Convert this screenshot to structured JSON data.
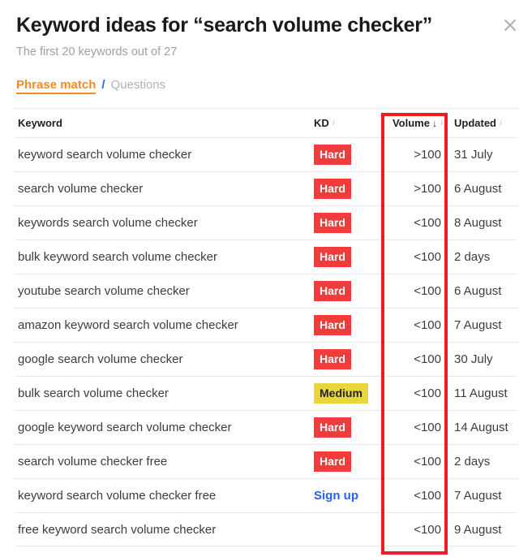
{
  "header": {
    "title": "Keyword ideas for “search volume checker”",
    "subtitle": "The first 20 keywords out of 27",
    "close_icon": "close-icon"
  },
  "tabs": {
    "active_label": "Phrase match",
    "separator": "/",
    "inactive_label": "Questions"
  },
  "table": {
    "columns": {
      "keyword": "Keyword",
      "kd": "KD",
      "volume": "Volume",
      "volume_sort_arrow": "↓",
      "updated": "Updated",
      "info_icon": "i"
    },
    "rows": [
      {
        "keyword": "keyword search volume checker",
        "kd": "Hard",
        "kd_type": "hard",
        "volume": ">100",
        "updated": "31 July"
      },
      {
        "keyword": "search volume checker",
        "kd": "Hard",
        "kd_type": "hard",
        "volume": ">100",
        "updated": "6 August"
      },
      {
        "keyword": "keywords search volume checker",
        "kd": "Hard",
        "kd_type": "hard",
        "volume": "<100",
        "updated": "8 August"
      },
      {
        "keyword": "bulk keyword search volume checker",
        "kd": "Hard",
        "kd_type": "hard",
        "volume": "<100",
        "updated": "2 days"
      },
      {
        "keyword": "youtube search volume checker",
        "kd": "Hard",
        "kd_type": "hard",
        "volume": "<100",
        "updated": "6 August"
      },
      {
        "keyword": "amazon keyword search volume checker",
        "kd": "Hard",
        "kd_type": "hard",
        "volume": "<100",
        "updated": "7 August"
      },
      {
        "keyword": "google search volume checker",
        "kd": "Hard",
        "kd_type": "hard",
        "volume": "<100",
        "updated": "30 July"
      },
      {
        "keyword": "bulk search volume checker",
        "kd": "Medium",
        "kd_type": "medium",
        "volume": "<100",
        "updated": "11 August"
      },
      {
        "keyword": "google keyword search volume checker",
        "kd": "Hard",
        "kd_type": "hard",
        "volume": "<100",
        "updated": "14 August"
      },
      {
        "keyword": "search volume checker free",
        "kd": "Hard",
        "kd_type": "hard",
        "volume": "<100",
        "updated": "2 days"
      },
      {
        "keyword": "keyword search volume checker free",
        "kd": "Sign up",
        "kd_type": "link",
        "volume": "<100",
        "updated": "7 August"
      },
      {
        "keyword": "free keyword search volume checker",
        "kd": "",
        "kd_type": "none",
        "volume": "<100",
        "updated": "9 August"
      }
    ]
  },
  "annotation": {
    "highlighted_column": "Volume",
    "box_color": "#ee1c25"
  },
  "colors": {
    "accent_orange": "#f28c28",
    "link_blue": "#2563eb",
    "badge_hard": "#f23b3b",
    "badge_medium": "#e8d63c",
    "annotation_red": "#ee1c25"
  }
}
